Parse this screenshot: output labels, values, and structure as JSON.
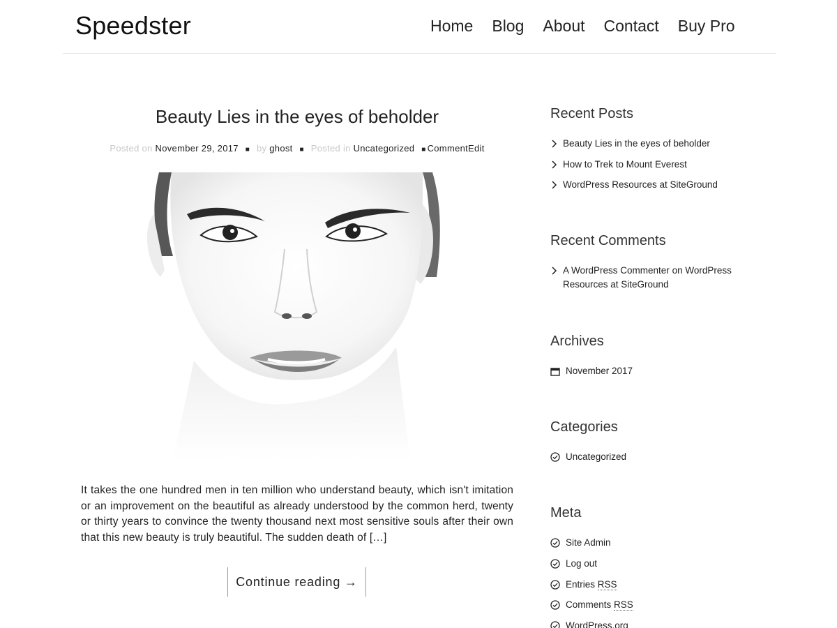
{
  "site": {
    "title": "Speedster"
  },
  "nav": {
    "items": [
      "Home",
      "Blog",
      "About",
      "Contact",
      "Buy Pro"
    ]
  },
  "post": {
    "title": "Beauty Lies in the eyes of beholder",
    "meta": {
      "posted_on_label": "Posted on",
      "date": "November 29, 2017",
      "by_label": "by",
      "author": "ghost",
      "posted_in_label": "Posted in",
      "category": "Uncategorized",
      "comment_link": "Comment",
      "edit_link": "Edit"
    },
    "excerpt": "It takes the one hundred men in ten million who understand beauty, which isn't imitation or an improvement on the beautiful as already understood by the common herd, twenty or thirty years to convince the twenty thousand next most sensitive souls after their own that this new beauty is truly beautiful. The sudden death of […]",
    "continue_label": "Continue reading →"
  },
  "sidebar": {
    "recent_posts": {
      "title": "Recent Posts",
      "items": [
        "Beauty Lies in the eyes of beholder",
        "How to Trek to Mount Everest",
        "WordPress Resources at SiteGround"
      ]
    },
    "recent_comments": {
      "title": "Recent Comments",
      "author": "A WordPress Commenter",
      "on_label": "on",
      "post": "WordPress Resources at SiteGround"
    },
    "archives": {
      "title": "Archives",
      "items": [
        "November 2017"
      ]
    },
    "categories": {
      "title": "Categories",
      "items": [
        "Uncategorized"
      ]
    },
    "meta": {
      "title": "Meta",
      "site_admin": "Site Admin",
      "log_out": "Log out",
      "entries_label": "Entries",
      "comments_label": "Comments",
      "rss_abbr": "RSS",
      "wordpress_org": "WordPress.org"
    }
  },
  "icons": {
    "list_chevron": "chevron-right-icon",
    "archive": "calendar-icon",
    "category": "check-circle-icon"
  }
}
